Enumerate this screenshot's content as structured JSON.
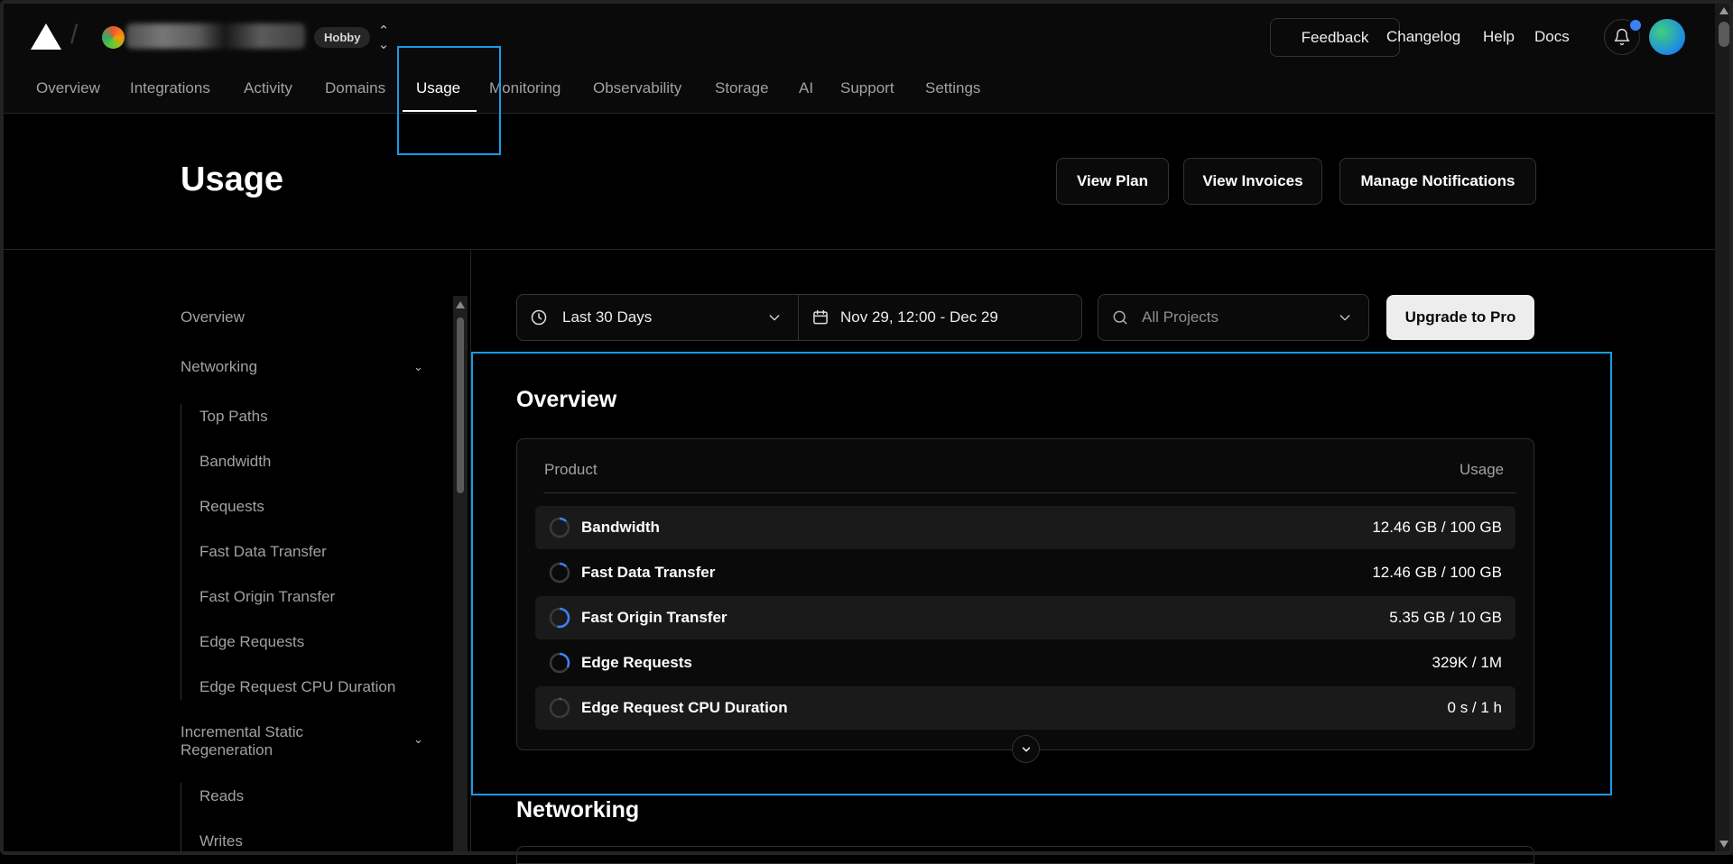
{
  "header": {
    "plan_badge": "Hobby",
    "feedback_label": "Feedback",
    "links": {
      "changelog": "Changelog",
      "help": "Help",
      "docs": "Docs"
    }
  },
  "nav": {
    "tabs": [
      {
        "label": "Overview"
      },
      {
        "label": "Integrations"
      },
      {
        "label": "Activity"
      },
      {
        "label": "Domains"
      },
      {
        "label": "Usage",
        "active": true
      },
      {
        "label": "Monitoring"
      },
      {
        "label": "Observability"
      },
      {
        "label": "Storage"
      },
      {
        "label": "AI"
      },
      {
        "label": "Support"
      },
      {
        "label": "Settings"
      }
    ]
  },
  "page": {
    "title": "Usage",
    "actions": {
      "view_plan": "View Plan",
      "view_invoices": "View Invoices",
      "manage_notifications": "Manage Notifications"
    }
  },
  "sidebar": {
    "overview": "Overview",
    "networking": {
      "label": "Networking",
      "items": [
        "Top Paths",
        "Bandwidth",
        "Requests",
        "Fast Data Transfer",
        "Fast Origin Transfer",
        "Edge Requests",
        "Edge Request CPU Duration"
      ]
    },
    "isr": {
      "label_line1": "Incremental Static",
      "label_line2": "Regeneration",
      "items": [
        "Reads",
        "Writes"
      ]
    }
  },
  "filters": {
    "range": "Last 30 Days",
    "dates": "Nov 29, 12:00 - Dec 29",
    "projects_placeholder": "All Projects",
    "upgrade_label": "Upgrade to Pro"
  },
  "overview": {
    "title": "Overview",
    "col_product": "Product",
    "col_usage": "Usage",
    "rows": [
      {
        "label": "Bandwidth",
        "value": "12.46 GB / 100 GB",
        "fraction": 0.1246
      },
      {
        "label": "Fast Data Transfer",
        "value": "12.46 GB / 100 GB",
        "fraction": 0.1246
      },
      {
        "label": "Fast Origin Transfer",
        "value": "5.35 GB / 10 GB",
        "fraction": 0.535
      },
      {
        "label": "Edge Requests",
        "value": "329K / 1M",
        "fraction": 0.329
      },
      {
        "label": "Edge Request CPU Duration",
        "value": "0 s / 1 h",
        "fraction": 0.02
      }
    ]
  },
  "networking_section": {
    "title": "Networking"
  },
  "colors": {
    "accent": "#3b82f6",
    "highlight": "#1a9be6",
    "background": "#000000"
  }
}
